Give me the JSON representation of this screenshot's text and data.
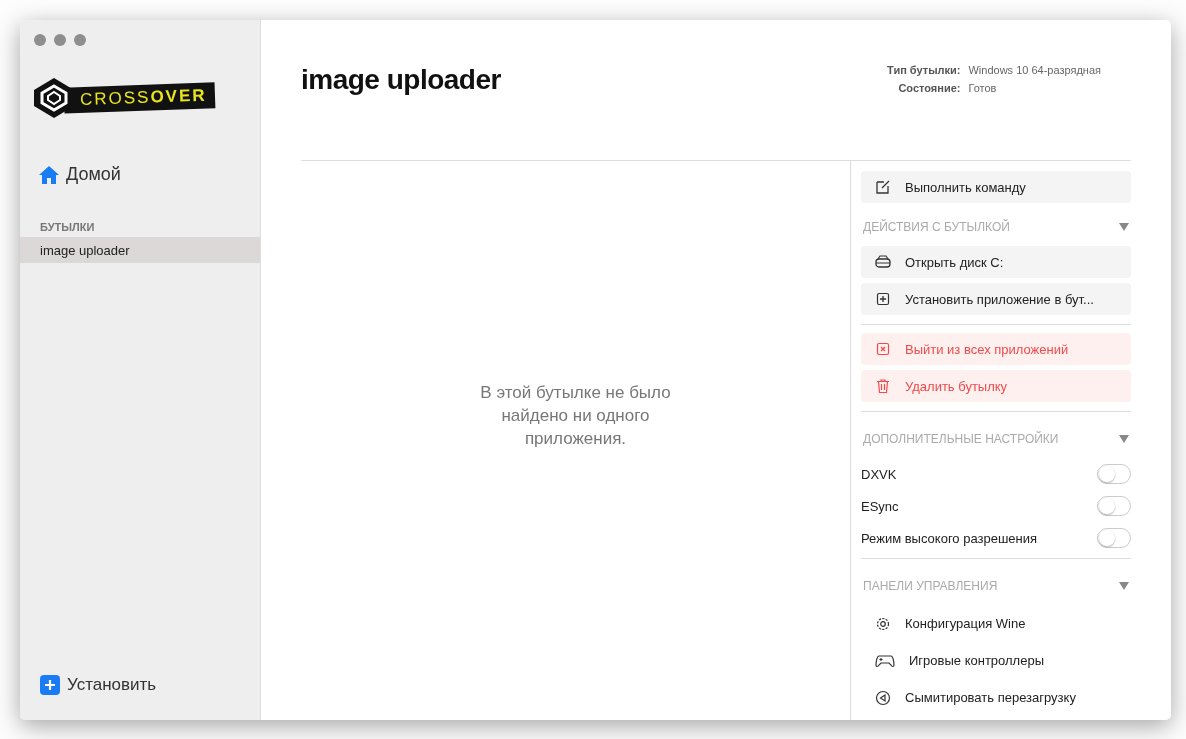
{
  "sidebar": {
    "logo": "CROSS**OVER**",
    "home": "Домой",
    "section": "БУТЫЛКИ",
    "bottles": [
      {
        "label": "image uploader",
        "selected": true
      }
    ],
    "install": "Установить"
  },
  "header": {
    "title": "image uploader",
    "info": [
      {
        "label": "Тип бутылки:",
        "value": "Windows 10 64-разрядная"
      },
      {
        "label": "Состояние:",
        "value": "Готов"
      }
    ]
  },
  "empty_message": "В этой бутылке не было найдено ни одного приложения.",
  "panel": {
    "run_command": "Выполнить команду",
    "sections": [
      {
        "title": "ДЕЙСТВИЯ С БУТЫЛКОЙ",
        "expanded": true,
        "kind": "buttons",
        "items": [
          {
            "label": "Открыть диск C:",
            "kind": "normal"
          },
          {
            "label": "Установить приложение в бут...",
            "kind": "normal"
          },
          {
            "label": "Выйти из всех приложений",
            "kind": "danger"
          },
          {
            "label": "Удалить бутылку",
            "kind": "danger"
          }
        ]
      },
      {
        "title": "ДОПОЛНИТЕЛЬНЫЕ НАСТРОЙКИ",
        "expanded": true,
        "kind": "toggles",
        "items": [
          {
            "label": "DXVK",
            "on": false
          },
          {
            "label": "ESync",
            "on": false
          },
          {
            "label": "Режим высокого разрешения",
            "on": false
          }
        ]
      },
      {
        "title": "ПАНЕЛИ УПРАВЛЕНИЯ",
        "expanded": true,
        "kind": "links",
        "items": [
          {
            "label": "Конфигурация Wine"
          },
          {
            "label": "Игровые контроллеры"
          },
          {
            "label": "Сымитировать перезагрузку"
          }
        ]
      }
    ]
  }
}
